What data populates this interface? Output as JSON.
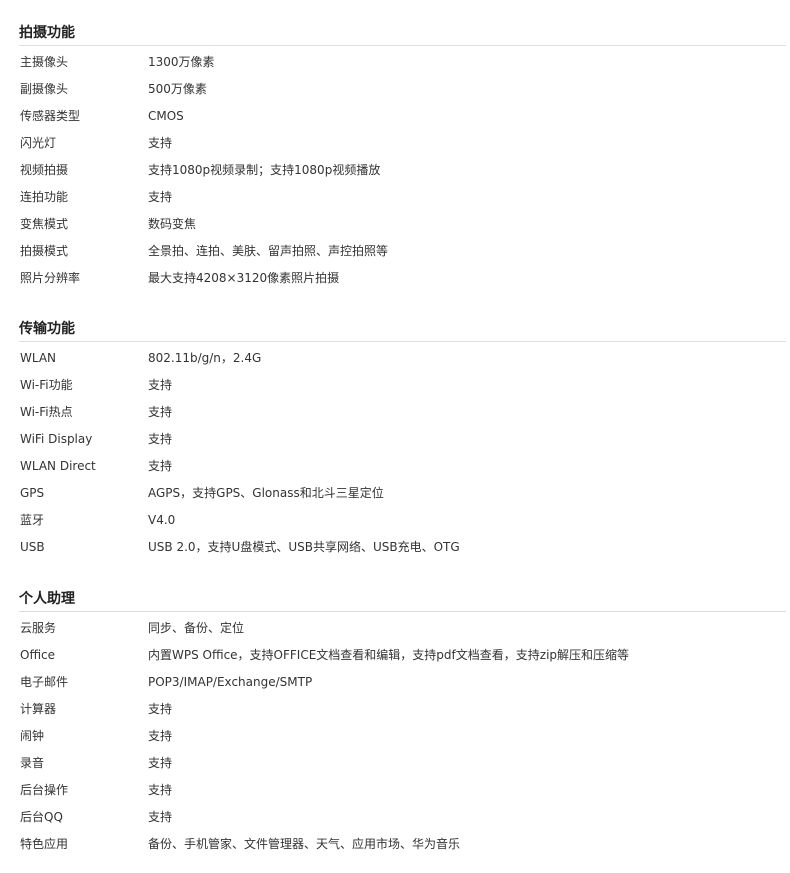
{
  "sections": [
    {
      "title": "拍摄功能",
      "rows": [
        {
          "label": "主摄像头",
          "value": "1300万像素"
        },
        {
          "label": "副摄像头",
          "value": "500万像素"
        },
        {
          "label": "传感器类型",
          "value": "CMOS"
        },
        {
          "label": "闪光灯",
          "value": "支持"
        },
        {
          "label": "视频拍摄",
          "value": "支持1080p视频录制；支持1080p视频播放"
        },
        {
          "label": "连拍功能",
          "value": "支持"
        },
        {
          "label": "变焦模式",
          "value": "数码变焦"
        },
        {
          "label": "拍摄模式",
          "value": "全景拍、连拍、美肤、留声拍照、声控拍照等"
        },
        {
          "label": "照片分辨率",
          "value": "最大支持4208×3120像素照片拍摄"
        }
      ]
    },
    {
      "title": "传输功能",
      "rows": [
        {
          "label": "WLAN",
          "value": "802.11b/g/n，2.4G"
        },
        {
          "label": "Wi-Fi功能",
          "value": "支持"
        },
        {
          "label": "Wi-Fi热点",
          "value": "支持"
        },
        {
          "label": "WiFi Display",
          "value": "支持"
        },
        {
          "label": "WLAN Direct",
          "value": "支持"
        },
        {
          "label": "GPS",
          "value": "AGPS，支持GPS、Glonass和北斗三星定位"
        },
        {
          "label": "蓝牙",
          "value": "V4.0"
        },
        {
          "label": "USB",
          "value": "USB 2.0，支持U盘模式、USB共享网络、USB充电、OTG"
        }
      ]
    },
    {
      "title": "个人助理",
      "rows": [
        {
          "label": "云服务",
          "value": "同步、备份、定位"
        },
        {
          "label": "Office",
          "value": "内置WPS Office，支持OFFICE文档查看和编辑，支持pdf文档查看，支持zip解压和压缩等"
        },
        {
          "label": "电子邮件",
          "value": "POP3/IMAP/Exchange/SMTP"
        },
        {
          "label": "计算器",
          "value": "支持"
        },
        {
          "label": "闹钟",
          "value": "支持"
        },
        {
          "label": "录音",
          "value": "支持"
        },
        {
          "label": "后台操作",
          "value": "支持"
        },
        {
          "label": "后台QQ",
          "value": "支持"
        },
        {
          "label": "特色应用",
          "value": "备份、手机管家、文件管理器、天气、应用市场、华为音乐"
        }
      ]
    }
  ]
}
